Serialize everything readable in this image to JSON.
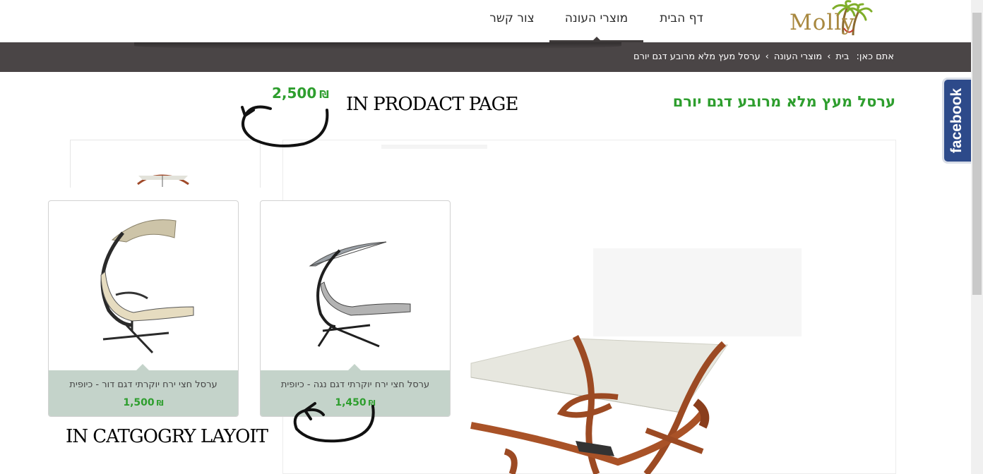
{
  "header": {
    "logo_text": "Molly",
    "nav": [
      {
        "label": "דף הבית"
      },
      {
        "label": "מוצרי העונה"
      },
      {
        "label": "צור קשר"
      }
    ]
  },
  "breadcrumb": {
    "prefix": "אתם כאן:",
    "items": [
      "בית",
      "מוצרי העונה",
      "ערסל מעץ מלא מרובע דגם יורם"
    ],
    "separator": "›"
  },
  "social": {
    "facebook_label": "facebook"
  },
  "product": {
    "title": "ערסל מעץ מלא מרובע דגם יורם",
    "price": "2,500",
    "currency": "₪"
  },
  "annotations": {
    "product_page": "IN PRODACT PAGE",
    "category_layout": "IN CATGOGRY LAYOIT"
  },
  "category_cards": [
    {
      "name": "ערסל חצי ירח יוקרתי דגם דור - כיופית",
      "price": "1,500",
      "currency": "₪"
    },
    {
      "name": "ערסל חצי ירח יוקרתי דגם נגה - כיופית",
      "price": "1,450",
      "currency": "₪"
    }
  ],
  "colors": {
    "price_green": "#2e9e2e",
    "breadcrumb_bar": "#4a4546",
    "card_footer": "#c4d3ca",
    "facebook_blue": "#2d4a8a"
  }
}
